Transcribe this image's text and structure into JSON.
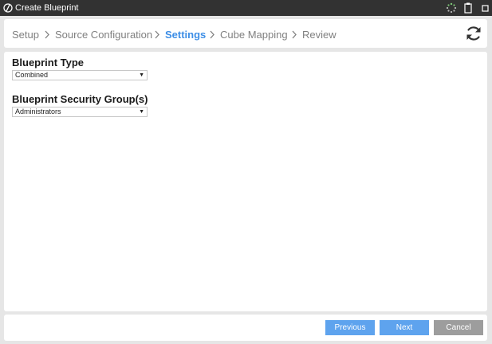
{
  "window": {
    "title": "Create Blueprint"
  },
  "wizard": {
    "steps": [
      {
        "label": "Setup",
        "active": false
      },
      {
        "label": "Source Configuration",
        "active": false
      },
      {
        "label": "Settings",
        "active": true
      },
      {
        "label": "Cube Mapping",
        "active": false
      },
      {
        "label": "Review",
        "active": false
      }
    ]
  },
  "form": {
    "blueprint_type": {
      "label": "Blueprint Type",
      "value": "Combined"
    },
    "security_groups": {
      "label": "Blueprint Security Group(s)",
      "value": "Administrators"
    }
  },
  "footer": {
    "previous_label": "Previous",
    "next_label": "Next",
    "cancel_label": "Cancel"
  },
  "icons": {
    "logo": "app-logo-icon",
    "loading": "loading-spinner-icon",
    "clipboard": "clipboard-icon",
    "maximize": "maximize-icon",
    "refresh": "refresh-icon",
    "dropdown": "caret-down-icon"
  },
  "colors": {
    "titlebar": "#323232",
    "active_step": "#3d8ee6",
    "inactive_step": "#808080",
    "primary_button": "#5ea3ee",
    "secondary_button": "#9d9d9d",
    "frame_background": "#e6e6e6"
  }
}
